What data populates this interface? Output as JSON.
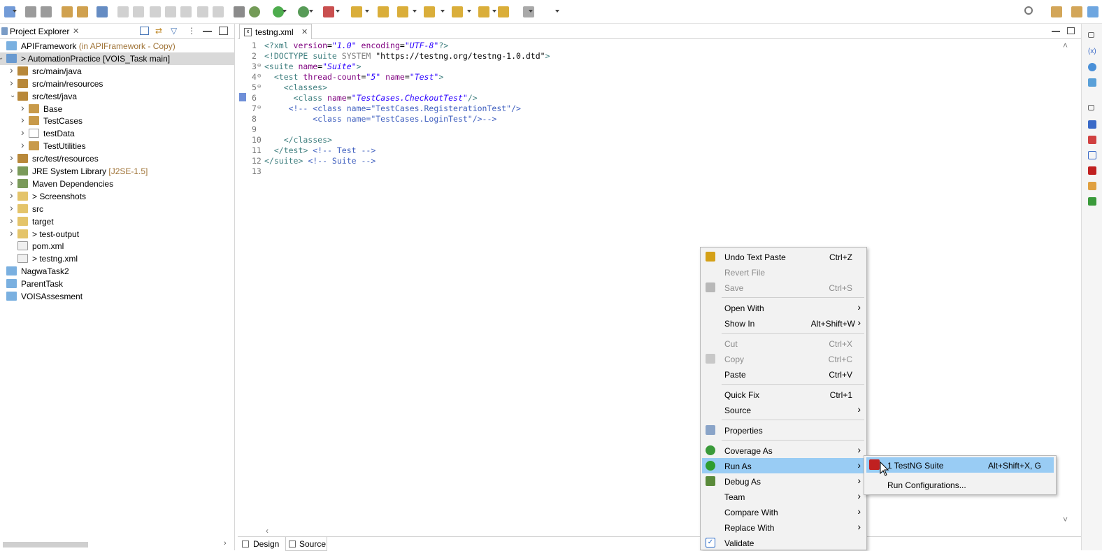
{
  "toolbar": {
    "icons": [
      "new-icon",
      "save-icon",
      "save-all-icon",
      "open-type-icon",
      "open-task-icon",
      "skip-breakpoints-icon",
      "resume-icon",
      "suspend-icon",
      "terminate-icon",
      "disconnect-icon",
      "step-into-icon",
      "step-over-icon",
      "step-return-icon",
      "drop-to-frame-icon",
      "debug-icon",
      "run-icon",
      "coverage-icon",
      "external-tools-icon",
      "open-folder-icon",
      "search-icon",
      "next-annotation-icon",
      "prev-annotation-icon",
      "back-icon",
      "forward-icon",
      "perspective-icon",
      "quick-access-icon"
    ]
  },
  "explorer": {
    "title": "Project Explorer",
    "items": [
      {
        "label": "APIFramework",
        "decor": " (in APIFramework - Copy)",
        "depth": 0,
        "twisty": "",
        "icon": "folder",
        "selected": false
      },
      {
        "label": "> AutomationPractice [VOIS_Task main]",
        "decor": "",
        "depth": 0,
        "twisty": "v",
        "icon": "maven-project",
        "selected": true
      },
      {
        "label": "src/main/java",
        "decor": "",
        "depth": 1,
        "twisty": ">",
        "icon": "source-folder",
        "selected": false
      },
      {
        "label": "src/main/resources",
        "decor": "",
        "depth": 1,
        "twisty": ">",
        "icon": "source-folder",
        "selected": false
      },
      {
        "label": "src/test/java",
        "decor": "",
        "depth": 1,
        "twisty": "v",
        "icon": "source-folder",
        "selected": false
      },
      {
        "label": "Base",
        "decor": "",
        "depth": 2,
        "twisty": ">",
        "icon": "package",
        "selected": false
      },
      {
        "label": "TestCases",
        "decor": "",
        "depth": 2,
        "twisty": ">",
        "icon": "package",
        "selected": false
      },
      {
        "label": "testData",
        "decor": "",
        "depth": 2,
        "twisty": ">",
        "icon": "package-empty",
        "selected": false
      },
      {
        "label": "TestUtilities",
        "decor": "",
        "depth": 2,
        "twisty": ">",
        "icon": "package",
        "selected": false
      },
      {
        "label": "src/test/resources",
        "decor": "",
        "depth": 1,
        "twisty": ">",
        "icon": "source-folder",
        "selected": false
      },
      {
        "label": "JRE System Library",
        "decor": " [J2SE-1.5]",
        "depth": 1,
        "twisty": ">",
        "icon": "library",
        "selected": false
      },
      {
        "label": "Maven Dependencies",
        "decor": "",
        "depth": 1,
        "twisty": ">",
        "icon": "library",
        "selected": false
      },
      {
        "label": "> Screenshots",
        "decor": "",
        "depth": 1,
        "twisty": ">",
        "icon": "folder-open",
        "selected": false
      },
      {
        "label": "src",
        "decor": "",
        "depth": 1,
        "twisty": ">",
        "icon": "folder-open",
        "selected": false
      },
      {
        "label": "target",
        "decor": "",
        "depth": 1,
        "twisty": ">",
        "icon": "folder-open",
        "selected": false
      },
      {
        "label": "> test-output",
        "decor": "",
        "depth": 1,
        "twisty": ">",
        "icon": "folder-open",
        "selected": false
      },
      {
        "label": "pom.xml",
        "decor": "",
        "depth": 1,
        "twisty": "",
        "icon": "xml-file",
        "selected": false
      },
      {
        "label": "> testng.xml",
        "decor": "",
        "depth": 1,
        "twisty": "",
        "icon": "xml-file",
        "selected": false
      },
      {
        "label": "NagwaTask2",
        "decor": "",
        "depth": 0,
        "twisty": "",
        "icon": "folder",
        "selected": false
      },
      {
        "label": "ParentTask",
        "decor": "",
        "depth": 0,
        "twisty": "",
        "icon": "folder",
        "selected": false
      },
      {
        "label": "VOISAssesment",
        "decor": "",
        "depth": 0,
        "twisty": "",
        "icon": "folder",
        "selected": false
      }
    ]
  },
  "editor": {
    "tab_label": "testng.xml",
    "lines": [
      {
        "n": "1",
        "fold": "",
        "parts": [
          [
            "tag",
            "<?xml "
          ],
          [
            "attr",
            "version"
          ],
          [
            "plain",
            "="
          ],
          [
            "val",
            "\"1.0\""
          ],
          [
            "plain",
            " "
          ],
          [
            "attr",
            "encoding"
          ],
          [
            "plain",
            "="
          ],
          [
            "val",
            "\"UTF-8\""
          ],
          [
            "tag",
            "?>"
          ]
        ]
      },
      {
        "n": "2",
        "fold": "",
        "parts": [
          [
            "tag",
            "<!DOCTYPE suite "
          ],
          [
            "dtd",
            "SYSTEM "
          ],
          [
            "plain",
            "\"https://testng.org/testng-1.0.dtd\""
          ],
          [
            "tag",
            ">"
          ]
        ]
      },
      {
        "n": "3",
        "fold": "⊖",
        "parts": [
          [
            "tag",
            "<suite "
          ],
          [
            "attr",
            "name"
          ],
          [
            "plain",
            "="
          ],
          [
            "val",
            "\"Suite\""
          ],
          [
            "tag",
            ">"
          ]
        ]
      },
      {
        "n": "4",
        "fold": "⊖",
        "parts": [
          [
            "tag",
            "  <test "
          ],
          [
            "attr",
            "thread-count"
          ],
          [
            "plain",
            "="
          ],
          [
            "val",
            "\"5\""
          ],
          [
            "plain",
            " "
          ],
          [
            "attr",
            "name"
          ],
          [
            "plain",
            "="
          ],
          [
            "val",
            "\"Test\""
          ],
          [
            "tag",
            ">"
          ]
        ]
      },
      {
        "n": "5",
        "fold": "⊖",
        "parts": [
          [
            "tag",
            "    <classes>"
          ]
        ]
      },
      {
        "n": "6",
        "fold": "",
        "parts": [
          [
            "tag",
            "      <class "
          ],
          [
            "attr",
            "name"
          ],
          [
            "plain",
            "="
          ],
          [
            "val",
            "\"TestCases.CheckoutTest\""
          ],
          [
            "tag",
            "/>"
          ]
        ]
      },
      {
        "n": "7",
        "fold": "⊖",
        "parts": [
          [
            "cmt",
            "     <!-- <class name=\"TestCases.RegisterationTest\"/>"
          ]
        ]
      },
      {
        "n": "8",
        "fold": "",
        "parts": [
          [
            "cmt",
            "          <class name=\"TestCases.LoginTest\"/>-->"
          ]
        ]
      },
      {
        "n": "9",
        "fold": "",
        "parts": []
      },
      {
        "n": "10",
        "fold": "",
        "parts": [
          [
            "tag",
            "    </classes>"
          ]
        ]
      },
      {
        "n": "11",
        "fold": "",
        "parts": [
          [
            "tag",
            "  </test> "
          ],
          [
            "cmt",
            "<!-- Test -->"
          ]
        ]
      },
      {
        "n": "12",
        "fold": "",
        "parts": [
          [
            "tag",
            "</suite> "
          ],
          [
            "cmt",
            "<!-- Suite -->"
          ]
        ]
      },
      {
        "n": "13",
        "fold": "",
        "parts": []
      }
    ],
    "bottom_tabs": {
      "design": "Design",
      "source": "Source"
    }
  },
  "context_menu": {
    "items": [
      {
        "type": "item",
        "label": "Undo Text Paste",
        "accel": "Ctrl+Z",
        "sub": false,
        "disabled": false,
        "highlight": false,
        "icon": "undo-icon",
        "icon_color": "#d4a017"
      },
      {
        "type": "item",
        "label": "Revert File",
        "accel": "",
        "sub": false,
        "disabled": true,
        "highlight": false,
        "icon": "",
        "icon_color": ""
      },
      {
        "type": "item",
        "label": "Save",
        "accel": "Ctrl+S",
        "sub": false,
        "disabled": true,
        "highlight": false,
        "icon": "save-icon",
        "icon_color": "#b8b8b8"
      },
      {
        "type": "sep"
      },
      {
        "type": "item",
        "label": "Open With",
        "accel": "",
        "sub": true,
        "disabled": false,
        "highlight": false,
        "icon": "",
        "icon_color": ""
      },
      {
        "type": "item",
        "label": "Show In",
        "accel": "Alt+Shift+W",
        "sub": true,
        "disabled": false,
        "highlight": false,
        "icon": "",
        "icon_color": ""
      },
      {
        "type": "sep"
      },
      {
        "type": "item",
        "label": "Cut",
        "accel": "Ctrl+X",
        "sub": false,
        "disabled": true,
        "highlight": false,
        "icon": "",
        "icon_color": ""
      },
      {
        "type": "item",
        "label": "Copy",
        "accel": "Ctrl+C",
        "sub": false,
        "disabled": true,
        "highlight": false,
        "icon": "copy-icon",
        "icon_color": "#c8c8c8"
      },
      {
        "type": "item",
        "label": "Paste",
        "accel": "Ctrl+V",
        "sub": false,
        "disabled": false,
        "highlight": false,
        "icon": "",
        "icon_color": ""
      },
      {
        "type": "sep"
      },
      {
        "type": "item",
        "label": "Quick Fix",
        "accel": "Ctrl+1",
        "sub": false,
        "disabled": false,
        "highlight": false,
        "icon": "",
        "icon_color": ""
      },
      {
        "type": "item",
        "label": "Source",
        "accel": "",
        "sub": true,
        "disabled": false,
        "highlight": false,
        "icon": "",
        "icon_color": ""
      },
      {
        "type": "sep"
      },
      {
        "type": "item",
        "label": "Properties",
        "accel": "",
        "sub": false,
        "disabled": false,
        "highlight": false,
        "icon": "properties-icon",
        "icon_color": "#8aa4c8"
      },
      {
        "type": "sep"
      },
      {
        "type": "item",
        "label": "Coverage As",
        "accel": "",
        "sub": true,
        "disabled": false,
        "highlight": false,
        "icon": "coverage-icon",
        "icon_color": "#3a9a3a"
      },
      {
        "type": "item",
        "label": "Run As",
        "accel": "",
        "sub": true,
        "disabled": false,
        "highlight": true,
        "icon": "run-icon",
        "icon_color": "#2e9d2e"
      },
      {
        "type": "item",
        "label": "Debug As",
        "accel": "",
        "sub": true,
        "disabled": false,
        "highlight": false,
        "icon": "debug-icon",
        "icon_color": "#5a8a3a"
      },
      {
        "type": "item",
        "label": "Team",
        "accel": "",
        "sub": true,
        "disabled": false,
        "highlight": false,
        "icon": "",
        "icon_color": ""
      },
      {
        "type": "item",
        "label": "Compare With",
        "accel": "",
        "sub": true,
        "disabled": false,
        "highlight": false,
        "icon": "",
        "icon_color": ""
      },
      {
        "type": "item",
        "label": "Replace With",
        "accel": "",
        "sub": true,
        "disabled": false,
        "highlight": false,
        "icon": "",
        "icon_color": ""
      },
      {
        "type": "item",
        "label": "Validate",
        "accel": "",
        "sub": false,
        "disabled": false,
        "highlight": false,
        "icon": "checkbox-icon",
        "icon_color": "#2a6ac8"
      }
    ]
  },
  "submenu": {
    "items": [
      {
        "label": "1 TestNG Suite",
        "accel": "Alt+Shift+X, G",
        "highlight": true,
        "icon": "testng-icon"
      },
      {
        "label": "Run Configurations...",
        "accel": "",
        "highlight": false,
        "icon": ""
      }
    ]
  },
  "colors": {
    "highlight": "#99ccf4",
    "selection": "#d9d9d9",
    "menu_bg": "#f2f2f2"
  }
}
